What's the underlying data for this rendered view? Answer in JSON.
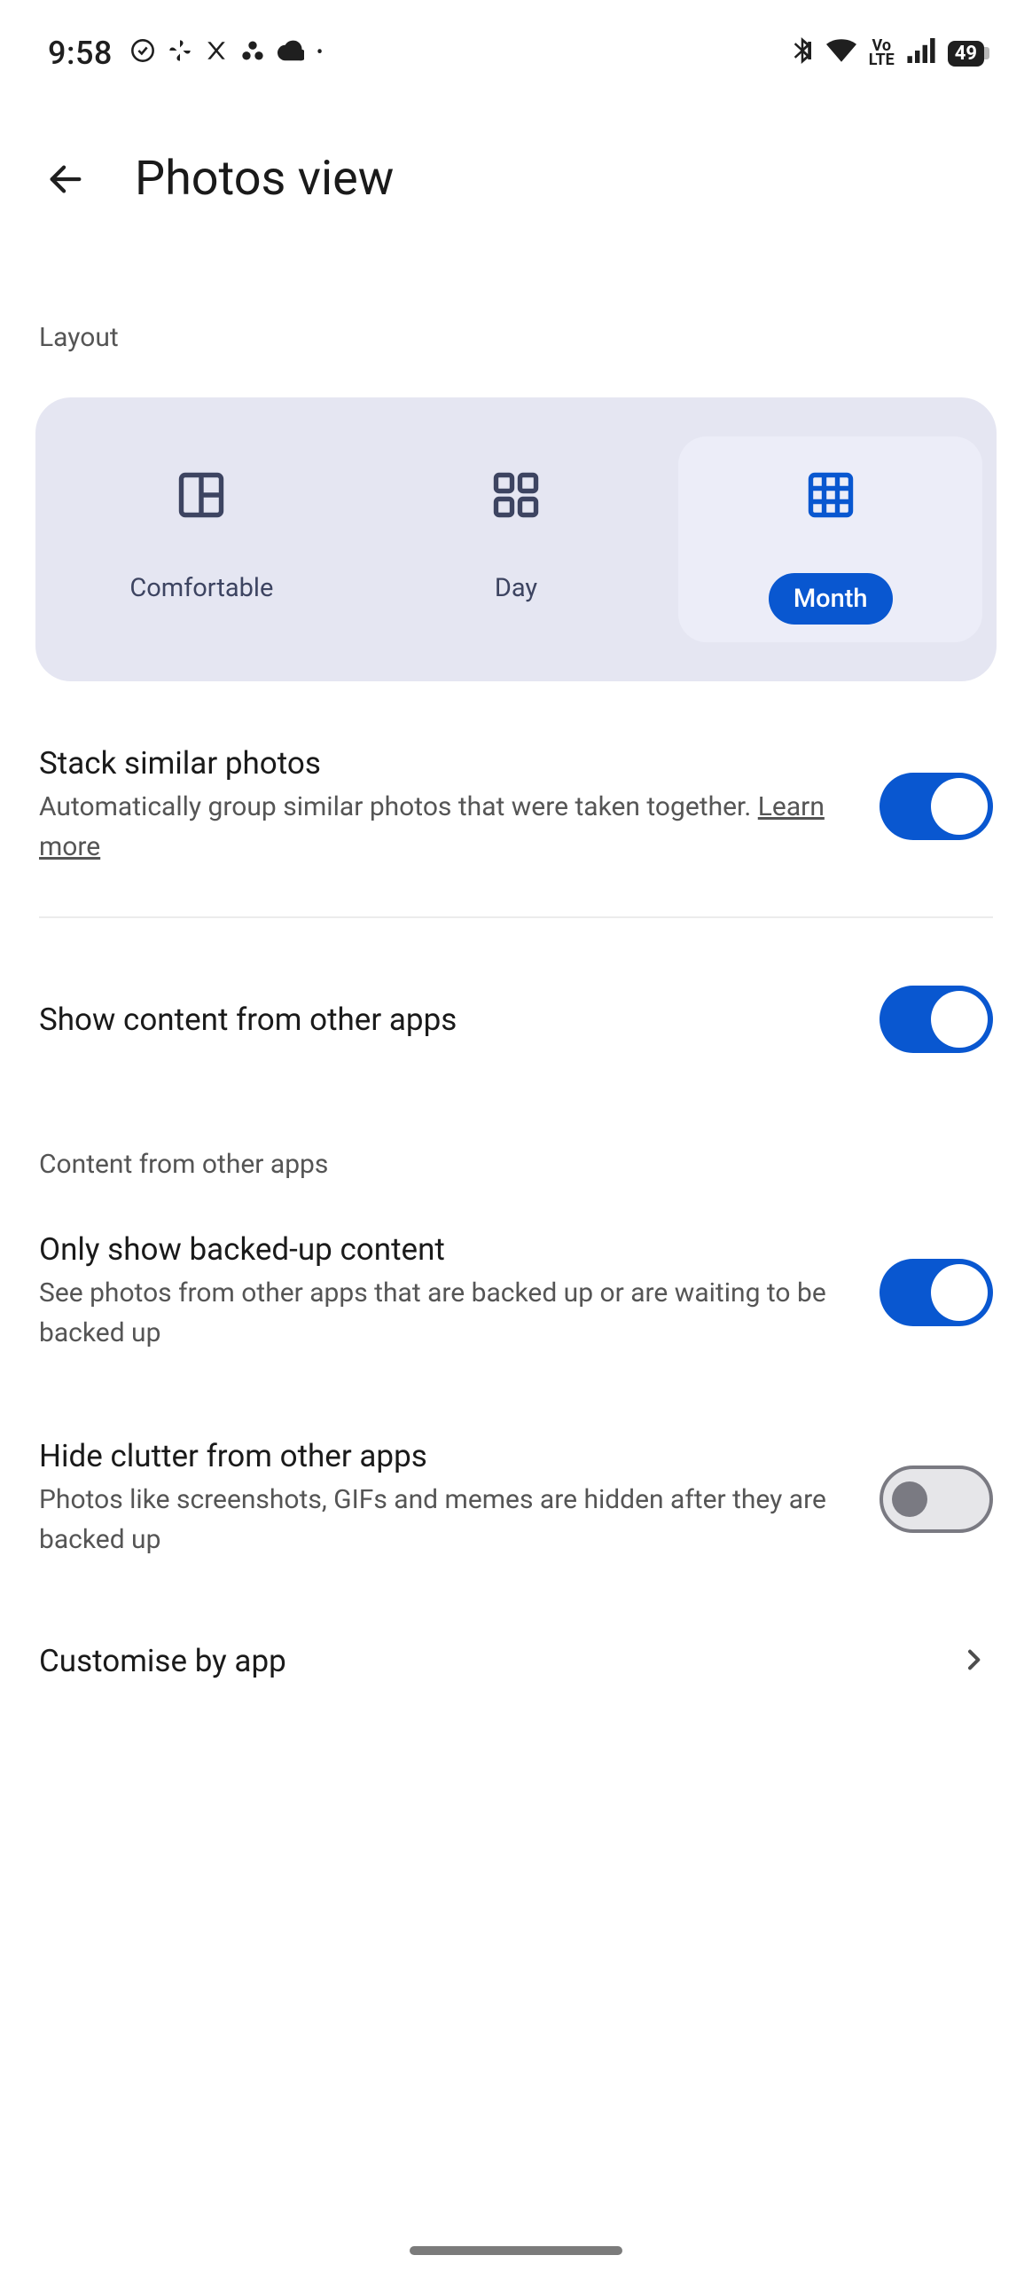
{
  "statusbar": {
    "time": "9:58",
    "battery": "49",
    "icons_left": [
      "check-circle",
      "pinwheel",
      "x",
      "dots",
      "cloud",
      "dot"
    ],
    "icons_right": [
      "bluetooth",
      "wifi",
      "volte",
      "signal",
      "battery"
    ]
  },
  "header": {
    "title": "Photos view"
  },
  "layout": {
    "label": "Layout",
    "options": [
      {
        "label": "Comfortable",
        "selected": false
      },
      {
        "label": "Day",
        "selected": false
      },
      {
        "label": "Month",
        "selected": true
      }
    ]
  },
  "settings": {
    "stack": {
      "title": "Stack similar photos",
      "desc": "Automatically group similar photos that were taken together. ",
      "learn_more": "Learn more",
      "on": true
    },
    "show_other": {
      "title": "Show content from other apps",
      "on": true
    },
    "content_subheader": "Content from other apps",
    "only_backed": {
      "title": "Only show backed-up content",
      "desc": "See photos from other apps that are backed up or are waiting to be backed up",
      "on": true
    },
    "hide_clutter": {
      "title": "Hide clutter from other apps",
      "desc": "Photos like screenshots, GIFs and memes are hidden after they are backed up",
      "on": false
    },
    "customise": {
      "title": "Customise by app"
    }
  }
}
